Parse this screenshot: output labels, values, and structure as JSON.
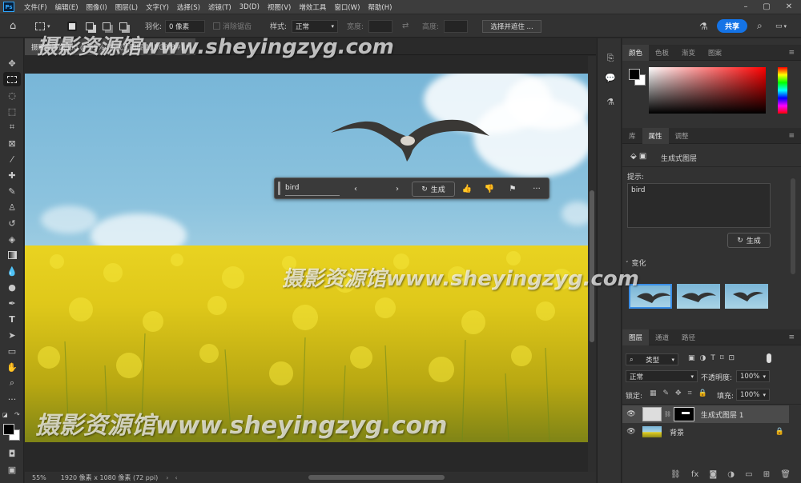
{
  "app": {
    "logo": "Ps"
  },
  "menu": [
    "文件(F)",
    "编辑(E)",
    "图像(I)",
    "图层(L)",
    "文字(Y)",
    "选择(S)",
    "滤镜(T)",
    "3D(D)",
    "视图(V)",
    "增效工具",
    "窗口(W)",
    "帮助(H)"
  ],
  "options": {
    "feather_label": "羽化:",
    "feather_value": "0 像素",
    "antialias_label": "消除锯齿",
    "style_label": "样式:",
    "style_value": "正常",
    "width_label": "宽度:",
    "height_label": "高度:",
    "select_mask_button": "选择并遮住 ...",
    "share_button": "共享"
  },
  "document": {
    "tab_title": "摄影资源馆.jpg @ 55% (生成式图层 1, RGB/8#) *"
  },
  "taskbar": {
    "prompt": "bird",
    "generate": "生成"
  },
  "status": {
    "zoom": "55%",
    "doc_info": "1920 像素 x 1080 像素 (72 ppi)"
  },
  "color_panel": {
    "tabs": [
      "颜色",
      "色板",
      "渐变",
      "图案"
    ],
    "foreground": "#000000",
    "background": "#ffffff"
  },
  "properties_panel": {
    "tabs": [
      "库",
      "属性",
      "调整"
    ],
    "layer_type": "生成式图层",
    "prompt_label": "提示:",
    "prompt_value": "bird",
    "generate_button": "生成",
    "variations_label": "变化"
  },
  "layers_panel": {
    "tabs": [
      "图层",
      "通道",
      "路径"
    ],
    "filter_kind": "类型",
    "blend_mode": "正常",
    "opacity_label": "不透明度:",
    "opacity_value": "100%",
    "lock_label": "锁定:",
    "fill_label": "填充:",
    "fill_value": "100%",
    "layers": [
      {
        "name": "生成式图层 1",
        "selected": true
      },
      {
        "name": "背景",
        "locked": true
      }
    ]
  },
  "watermark": {
    "top": "摄影资源馆www.sheyingzyg.com",
    "middle": "摄影资源馆www.sheyingzyg.com",
    "bottom": "摄影资源馆www.sheyingzyg.com"
  }
}
